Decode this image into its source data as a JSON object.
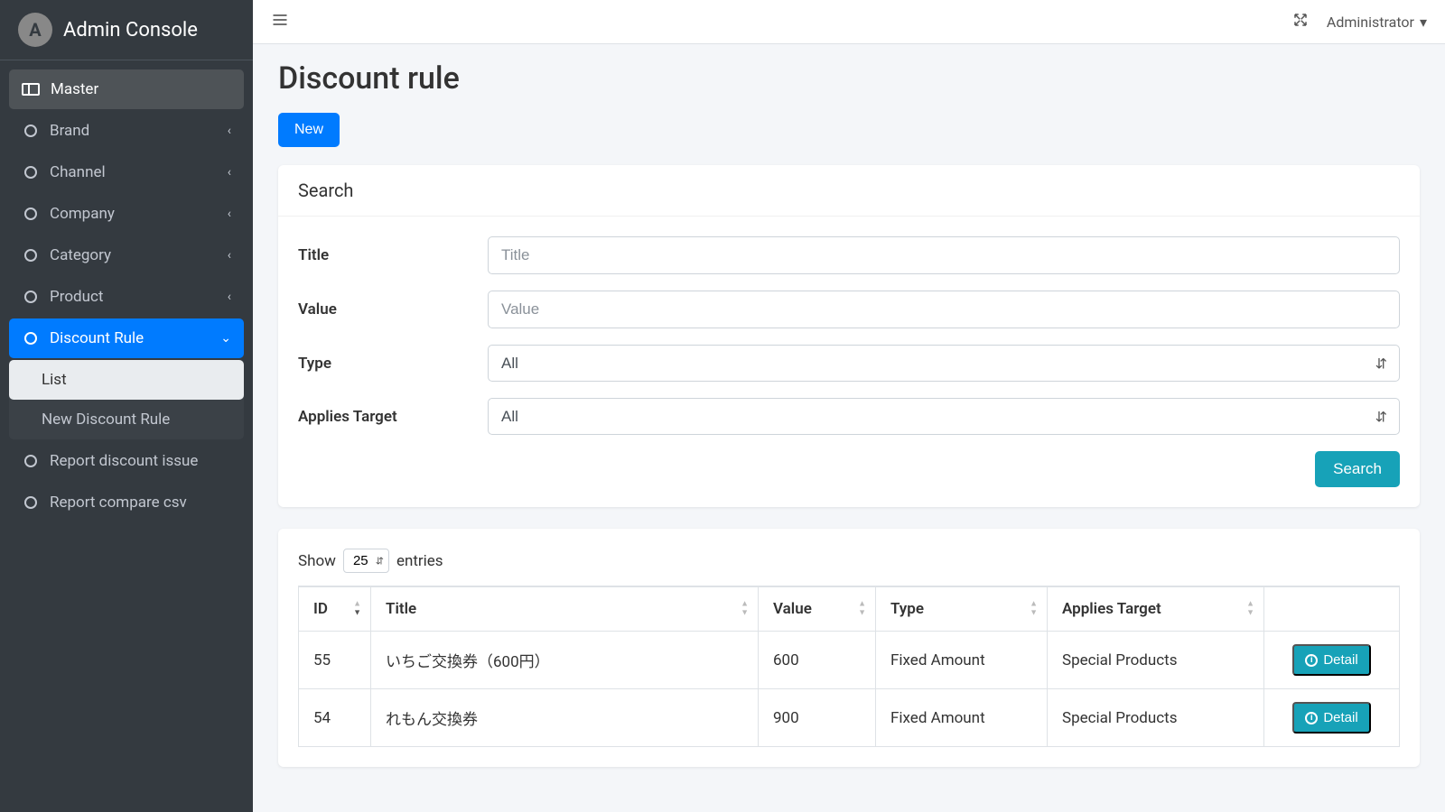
{
  "brand": {
    "logo_letter": "A",
    "title": "Admin Console"
  },
  "topbar": {
    "user_label": "Administrator"
  },
  "sidebar": {
    "master_label": "Master",
    "items": [
      {
        "label": "Brand"
      },
      {
        "label": "Channel"
      },
      {
        "label": "Company"
      },
      {
        "label": "Category"
      },
      {
        "label": "Product"
      },
      {
        "label": "Discount Rule"
      },
      {
        "label": "Report discount issue"
      },
      {
        "label": "Report compare csv"
      }
    ],
    "discount_sub": [
      {
        "label": "List"
      },
      {
        "label": "New Discount Rule"
      }
    ]
  },
  "page": {
    "title": "Discount rule",
    "new_button": "New"
  },
  "search": {
    "panel_title": "Search",
    "title_label": "Title",
    "title_placeholder": "Title",
    "value_label": "Value",
    "value_placeholder": "Value",
    "type_label": "Type",
    "type_selected": "All",
    "applies_label": "Applies Target",
    "applies_selected": "All",
    "button": "Search"
  },
  "table": {
    "show_prefix": "Show",
    "show_suffix": "entries",
    "page_size": "25",
    "headers": {
      "id": "ID",
      "title": "Title",
      "value": "Value",
      "type": "Type",
      "applies": "Applies Target"
    },
    "detail_label": "Detail",
    "rows": [
      {
        "id": "55",
        "title": "いちご交換券（600円）",
        "value": "600",
        "type": "Fixed Amount",
        "applies": "Special Products"
      },
      {
        "id": "54",
        "title": "れもん交換券",
        "value": "900",
        "type": "Fixed Amount",
        "applies": "Special Products"
      }
    ]
  }
}
